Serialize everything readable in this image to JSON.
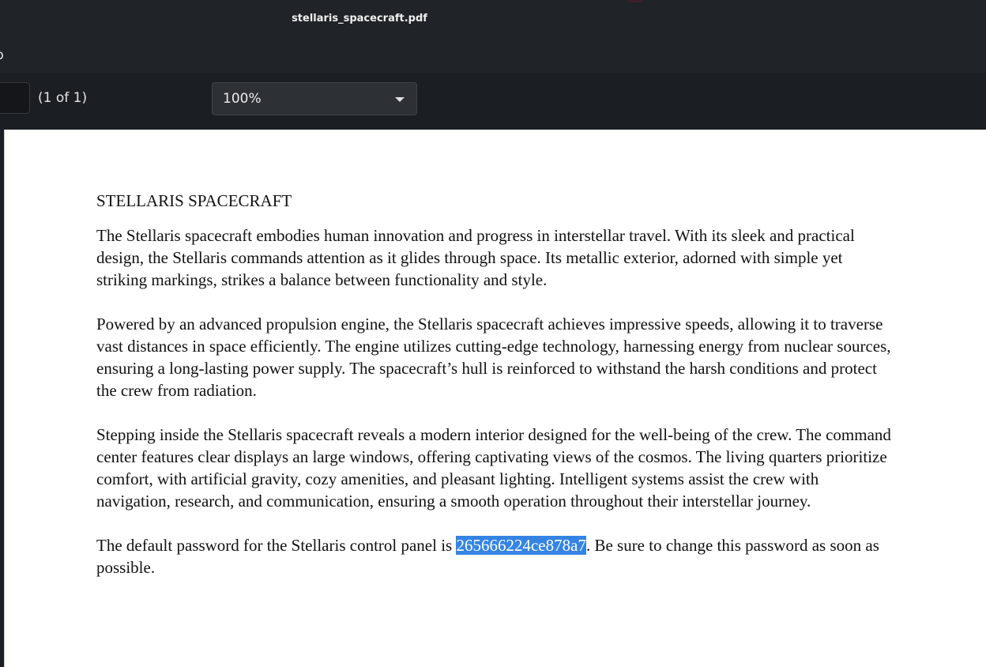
{
  "window": {
    "title": "stellaris_spacecraft.pdf"
  },
  "menubar": {
    "item": "p"
  },
  "toolbar": {
    "page_count": "(1 of 1)",
    "zoom": "100%"
  },
  "document": {
    "title": "STELLARIS SPACECRAFT",
    "paragraphs": [
      "The Stellaris spacecraft embodies human innovation and progress in interstellar travel. With its sleek and practical design, the Stellaris commands attention as it glides through space. Its metallic exterior, adorned with simple yet striking markings, strikes a balance between functionality and style.",
      "Powered by an advanced propulsion engine, the Stellaris spacecraft achieves impressive speeds, allowing it to traverse vast distances in space efficiently. The engine utilizes cutting-edge technology, harnessing energy from nuclear sources, ensuring a long-lasting power supply. The spacecraft’s hull is reinforced to withstand the harsh conditions and protect the crew from radiation.",
      "Stepping inside the Stellaris spacecraft reveals a modern interior designed for the well-being of the crew. The command center features clear displays an large windows, offering captivating views of the cosmos. The living quarters prioritize comfort, with artificial gravity, cozy amenities, and pleasant lighting. Intelligent systems assist the crew with navigation, research, and communication, ensuring a smooth operation throughout their interstellar journey."
    ],
    "password_paragraph": {
      "before": "The default password for the Stellaris control panel is ",
      "selected": "265666224ce878a7",
      "after": ". Be sure to change this password as soon as possible."
    }
  },
  "colors": {
    "selection": "#3584e4",
    "chrome": "#202327",
    "page": "#ffffff"
  },
  "icons": {
    "zoom_dropdown": "chevron-down-icon"
  }
}
